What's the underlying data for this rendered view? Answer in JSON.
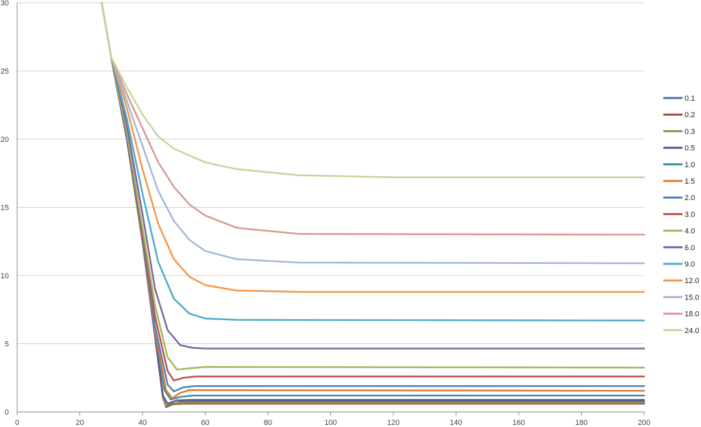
{
  "chart_data": {
    "type": "line",
    "title": "",
    "xlabel": "",
    "ylabel": "",
    "xlim": [
      0,
      200
    ],
    "ylim": [
      0,
      30
    ],
    "xticks": [
      "0",
      "20",
      "40",
      "60",
      "80",
      "100",
      "120",
      "140",
      "160",
      "180",
      "200"
    ],
    "yticks": [
      "0",
      "5",
      "10",
      "15",
      "20",
      "25",
      "30"
    ],
    "grid": "horizontal",
    "legend_position": "right",
    "series": [
      {
        "name": "0.1",
        "color": "#4a6fa5",
        "points": [
          [
            27,
            30
          ],
          [
            30,
            26
          ],
          [
            35,
            20
          ],
          [
            40,
            12.5
          ],
          [
            44,
            5.5
          ],
          [
            46.5,
            1.2
          ],
          [
            47.5,
            0.35
          ],
          [
            49,
            0.5
          ],
          [
            52,
            0.75
          ],
          [
            60,
            0.78
          ],
          [
            200,
            0.78
          ]
        ]
      },
      {
        "name": "0.2",
        "color": "#a94743",
        "points": [
          [
            27,
            30
          ],
          [
            30,
            26
          ],
          [
            35,
            20
          ],
          [
            40,
            12.5
          ],
          [
            44,
            5.5
          ],
          [
            46.5,
            1.1
          ],
          [
            47.5,
            0.4
          ],
          [
            49,
            0.55
          ],
          [
            53,
            0.6
          ],
          [
            60,
            0.6
          ],
          [
            200,
            0.6
          ]
        ]
      },
      {
        "name": "0.3",
        "color": "#7f9a48",
        "points": [
          [
            27,
            30
          ],
          [
            30,
            26
          ],
          [
            35,
            20
          ],
          [
            40,
            12.5
          ],
          [
            44,
            5.5
          ],
          [
            46.5,
            1.0
          ],
          [
            47.5,
            0.45
          ],
          [
            49,
            0.6
          ],
          [
            53,
            0.68
          ],
          [
            60,
            0.68
          ],
          [
            200,
            0.68
          ]
        ]
      },
      {
        "name": "0.5",
        "color": "#6a4f8c",
        "points": [
          [
            27,
            30
          ],
          [
            30,
            26
          ],
          [
            35,
            20
          ],
          [
            40,
            12.5
          ],
          [
            44,
            5.6
          ],
          [
            46.5,
            1.2
          ],
          [
            48,
            0.6
          ],
          [
            51,
            0.85
          ],
          [
            55,
            0.88
          ],
          [
            200,
            0.88
          ]
        ]
      },
      {
        "name": "1.0",
        "color": "#3e8ea8",
        "points": [
          [
            27,
            30
          ],
          [
            30,
            26
          ],
          [
            35,
            20
          ],
          [
            40,
            12.6
          ],
          [
            44,
            5.8
          ],
          [
            47,
            1.6
          ],
          [
            49,
            0.9
          ],
          [
            52,
            1.1
          ],
          [
            56,
            1.2
          ],
          [
            200,
            1.2
          ]
        ]
      },
      {
        "name": "1.5",
        "color": "#e07a2e",
        "points": [
          [
            27,
            30
          ],
          [
            30,
            26
          ],
          [
            35,
            20
          ],
          [
            40,
            12.6
          ],
          [
            44,
            6.0
          ],
          [
            47.5,
            1.6
          ],
          [
            49.5,
            1.0
          ],
          [
            52,
            1.4
          ],
          [
            55,
            1.6
          ],
          [
            200,
            1.55
          ]
        ]
      },
      {
        "name": "2.0",
        "color": "#4f81bd",
        "points": [
          [
            27,
            30
          ],
          [
            30,
            26
          ],
          [
            35,
            20
          ],
          [
            40,
            12.7
          ],
          [
            44,
            6.3
          ],
          [
            48,
            2.0
          ],
          [
            50,
            1.5
          ],
          [
            53,
            1.8
          ],
          [
            57,
            1.9
          ],
          [
            200,
            1.9
          ]
        ]
      },
      {
        "name": "3.0",
        "color": "#c0504d",
        "points": [
          [
            27,
            30
          ],
          [
            30,
            26
          ],
          [
            35,
            20.3
          ],
          [
            40,
            13.0
          ],
          [
            44,
            7.0
          ],
          [
            48,
            3.0
          ],
          [
            50,
            2.3
          ],
          [
            53,
            2.5
          ],
          [
            57,
            2.6
          ],
          [
            200,
            2.6
          ]
        ]
      },
      {
        "name": "4.0",
        "color": "#9bbb59",
        "points": [
          [
            27,
            30
          ],
          [
            30,
            26
          ],
          [
            35,
            20.5
          ],
          [
            40,
            13.5
          ],
          [
            44,
            7.8
          ],
          [
            48,
            4.0
          ],
          [
            51,
            3.1
          ],
          [
            55,
            3.2
          ],
          [
            60,
            3.3
          ],
          [
            200,
            3.25
          ]
        ]
      },
      {
        "name": "6.0",
        "color": "#8064a2",
        "points": [
          [
            27,
            30
          ],
          [
            30,
            26
          ],
          [
            35,
            21
          ],
          [
            40,
            14.5
          ],
          [
            44,
            9.0
          ],
          [
            48,
            6.0
          ],
          [
            52,
            4.9
          ],
          [
            56,
            4.7
          ],
          [
            60,
            4.65
          ],
          [
            200,
            4.65
          ]
        ]
      },
      {
        "name": "9.0",
        "color": "#4bacc6",
        "points": [
          [
            27,
            30
          ],
          [
            30,
            26
          ],
          [
            35,
            21.5
          ],
          [
            40,
            16.0
          ],
          [
            45,
            11.0
          ],
          [
            50,
            8.3
          ],
          [
            55,
            7.2
          ],
          [
            60,
            6.85
          ],
          [
            70,
            6.75
          ],
          [
            200,
            6.7
          ]
        ]
      },
      {
        "name": "12.0",
        "color": "#f79646",
        "points": [
          [
            27,
            30
          ],
          [
            30,
            26
          ],
          [
            35,
            22.3
          ],
          [
            40,
            17.8
          ],
          [
            45,
            13.8
          ],
          [
            50,
            11.2
          ],
          [
            55,
            9.9
          ],
          [
            60,
            9.3
          ],
          [
            70,
            8.9
          ],
          [
            90,
            8.8
          ],
          [
            200,
            8.8
          ]
        ]
      },
      {
        "name": "15.0",
        "color": "#a5b8d6",
        "points": [
          [
            27,
            30
          ],
          [
            30,
            26
          ],
          [
            35,
            22.8
          ],
          [
            40,
            19.5
          ],
          [
            45,
            16.2
          ],
          [
            50,
            14.0
          ],
          [
            55,
            12.6
          ],
          [
            60,
            11.8
          ],
          [
            70,
            11.2
          ],
          [
            90,
            10.95
          ],
          [
            200,
            10.9
          ]
        ]
      },
      {
        "name": "18.0",
        "color": "#d99894",
        "points": [
          [
            27,
            30
          ],
          [
            30,
            26
          ],
          [
            35,
            23.3
          ],
          [
            40,
            20.8
          ],
          [
            45,
            18.3
          ],
          [
            50,
            16.5
          ],
          [
            55,
            15.2
          ],
          [
            60,
            14.4
          ],
          [
            70,
            13.5
          ],
          [
            90,
            13.05
          ],
          [
            200,
            13.0
          ]
        ]
      },
      {
        "name": "24.0",
        "color": "#c3d69b",
        "points": [
          [
            27,
            30
          ],
          [
            30,
            26
          ],
          [
            35,
            23.8
          ],
          [
            40,
            21.8
          ],
          [
            45,
            20.2
          ],
          [
            50,
            19.3
          ],
          [
            55,
            18.8
          ],
          [
            60,
            18.3
          ],
          [
            70,
            17.8
          ],
          [
            90,
            17.35
          ],
          [
            120,
            17.2
          ],
          [
            200,
            17.2
          ]
        ]
      }
    ]
  }
}
